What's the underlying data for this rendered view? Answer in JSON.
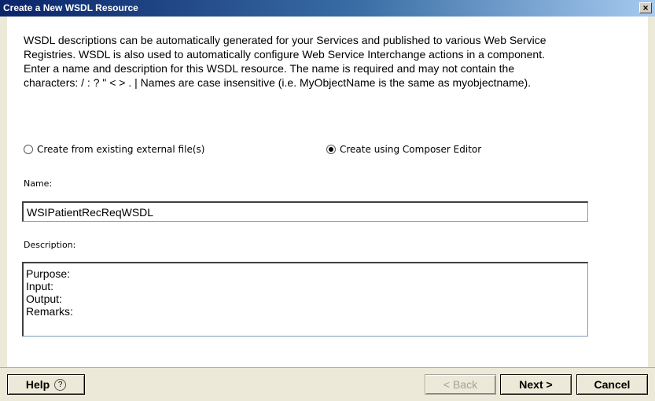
{
  "window": {
    "title": "Create a New WSDL Resource",
    "close_glyph": "×"
  },
  "intro": {
    "line1": "WSDL descriptions can be automatically generated for your Services and published to various Web Service",
    "line2": "Registries.  WSDL is also used to automatically configure Web Service Interchange actions in a component.",
    "line3": "Enter a name and description for this WSDL resource.  The name is required and may not contain the",
    "line4": "characters:  / : ? \" < > . |  Names are case insensitive (i.e. MyObjectName is the same as myobjectname)."
  },
  "options": {
    "external": {
      "label": "Create from existing external file(s)",
      "checked": false
    },
    "composer": {
      "label": "Create using Composer Editor",
      "checked": true
    }
  },
  "name_field": {
    "label": "Name:",
    "value": "WSIPatientRecReqWSDL"
  },
  "description_field": {
    "label": "Description:",
    "value": "Purpose:\nInput:\nOutput:\nRemarks:"
  },
  "buttons": {
    "help": "Help",
    "help_icon": "?",
    "back": "< Back",
    "next": "Next >",
    "cancel": "Cancel"
  }
}
